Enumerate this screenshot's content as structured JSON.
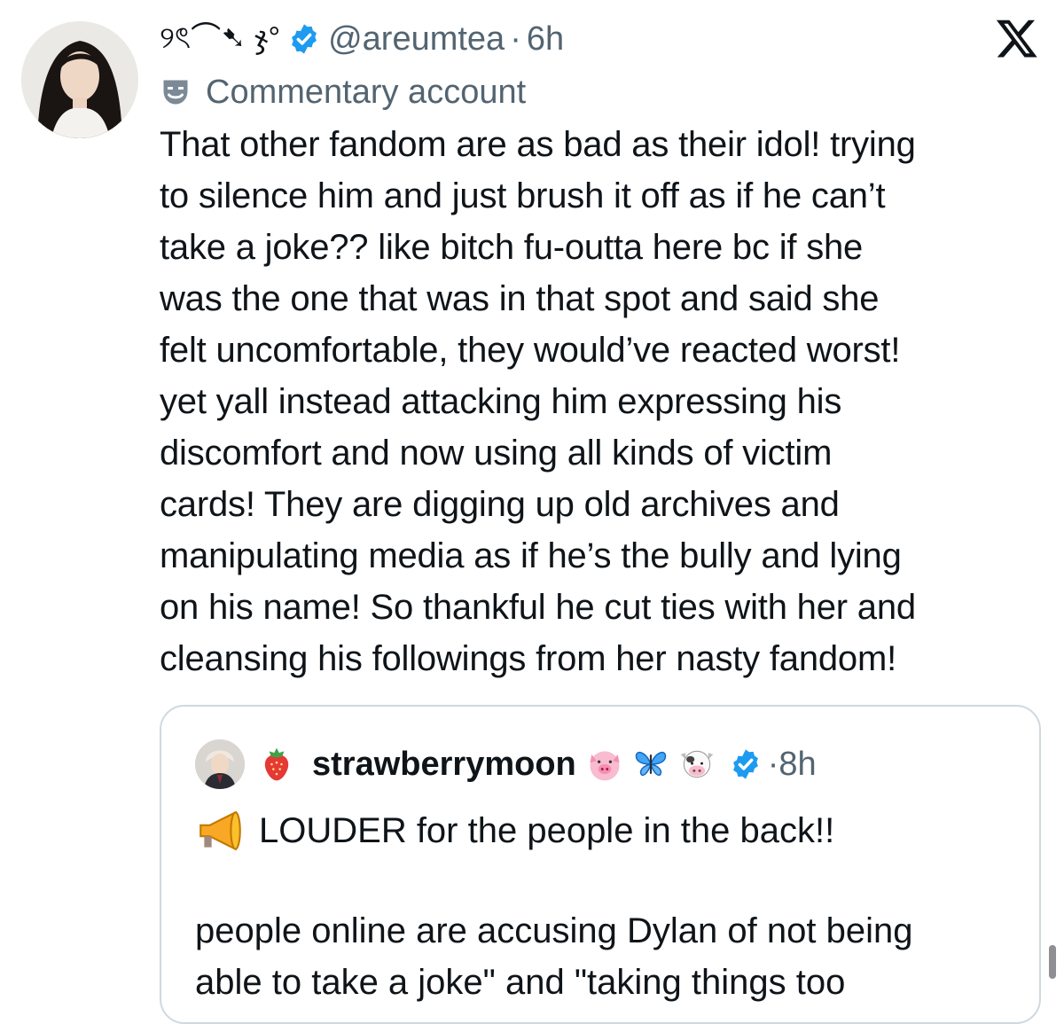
{
  "tweet": {
    "display_name": "୨ৎ⌒➷ ჯ°",
    "handle": "@areumtea",
    "separator": "·",
    "time": "6h",
    "label": "Commentary account",
    "text_lines": [
      "That other fandom are as bad as their idol! trying",
      "to silence him and just brush it off as if he can’t",
      "take a joke?? like bitch fu-outta here bc if she",
      "was the one that was in that spot and said she",
      "felt uncomfortable, they would’ve reacted worst!",
      "yet yall instead attacking him expressing his",
      "discomfort and now using all kinds of victim",
      "cards! They are digging up old archives and",
      "manipulating media as if he’s the bully and lying",
      "on his name! So thankful he cut ties with her and",
      "cleansing his followings from her nasty fandom!"
    ]
  },
  "quote": {
    "name": "strawberrymoon",
    "separator": "·",
    "time": "8h",
    "line1": "LOUDER for the people in the back!!",
    "line2": "people online are accusing Dylan of not being",
    "line3": "able to take a joke\" and \"taking things too"
  },
  "icons": {
    "verified": "verified-badge-icon",
    "label": "theater-masks-icon",
    "brand": "x-logo-icon",
    "emoji_strawberry": "strawberry-icon",
    "emoji_pig": "pig-face-icon",
    "emoji_butterfly": "butterfly-icon",
    "emoji_cow": "cow-face-icon",
    "emoji_megaphone": "megaphone-icon"
  },
  "colors": {
    "verified_blue": "#1d9bf0",
    "text": "#0f1419",
    "secondary": "#536471",
    "border": "#cfd9de"
  }
}
